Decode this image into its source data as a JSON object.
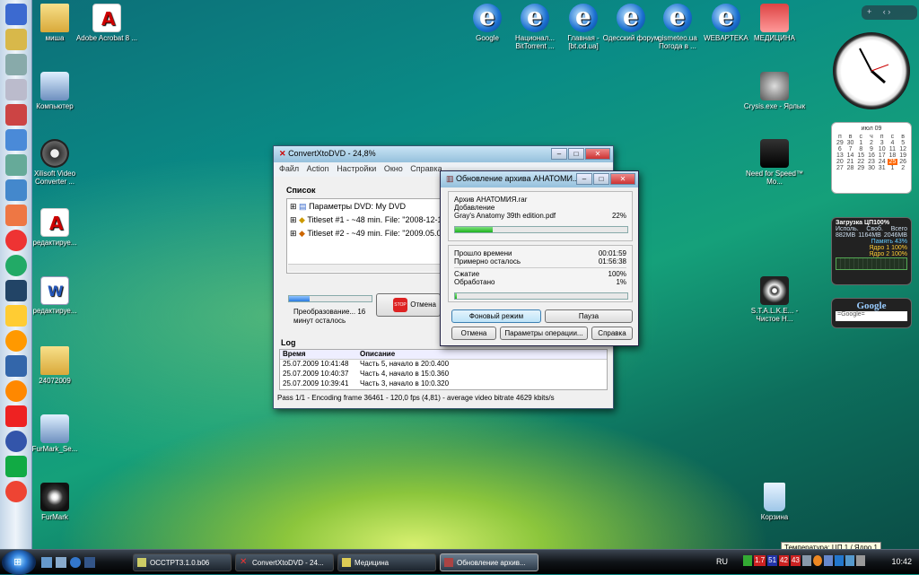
{
  "desktop_icons": [
    {
      "label": "миша",
      "type": "folder"
    },
    {
      "label": "Adobe Acrobat 8 ...",
      "type": "pdf"
    },
    {
      "label": "Компьютер",
      "type": "computer"
    },
    {
      "label": "Xilisoft Video Converter ...",
      "type": "film"
    },
    {
      "label": "редактируе...",
      "type": "pdf"
    },
    {
      "label": "редактируе...",
      "type": "doc"
    },
    {
      "label": "24072009",
      "type": "folder"
    },
    {
      "label": "FurMark_Se...",
      "type": "app"
    },
    {
      "label": "FurMark",
      "type": "game"
    },
    {
      "label": "Google",
      "type": "ie"
    },
    {
      "label": "Национал... BitTorrent ...",
      "type": "ie"
    },
    {
      "label": "Главная - [bt.od.ua]",
      "type": "ie"
    },
    {
      "label": "Одесский форум",
      "type": "ie"
    },
    {
      "label": "gismeteo.ua Погода в ...",
      "type": "ie"
    },
    {
      "label": "WEBAPTEKA",
      "type": "ie"
    },
    {
      "label": "МЕДИЦИНА",
      "type": "med"
    },
    {
      "label": "Crysis.exe - Ярлык",
      "type": "crysis"
    },
    {
      "label": "Need for Speed™ Mo...",
      "type": "nfs"
    },
    {
      "label": "S.T.A.L.K.E... - Чистое Н...",
      "type": "stalker"
    },
    {
      "label": "Корзина",
      "type": "recycle"
    }
  ],
  "convert_window": {
    "title": "ConvertXtoDVD - 24,8%",
    "menu": [
      "Файл",
      "Action",
      "Настройки",
      "Окно",
      "Справка"
    ],
    "list_header": "Список",
    "tree": [
      "Параметры DVD: My DVD",
      "Titleset #1 - ~48 min. File: \"2008-12-13...",
      "Titleset #2 - ~49 min. File: \"2009.05.02..."
    ],
    "progress_pct": 24.8,
    "status": "Преобразование... 16 минут осталось",
    "cancel_label": "Отмена",
    "stop_label": "STOP",
    "log_header": "Log",
    "log_columns": [
      "Время",
      "Описание"
    ],
    "log_rows": [
      {
        "time": "25.07.2009 10:41:48",
        "desc": "Часть 5, начало в 20:0.400"
      },
      {
        "time": "25.07.2009 10:40:37",
        "desc": "Часть 4, начало в 15:0.360"
      },
      {
        "time": "25.07.2009 10:39:41",
        "desc": "Часть 3, начало в 10:0.320"
      }
    ],
    "statusbar": "Pass 1/1 - Encoding frame 36461 - 120,0 fps (4,81) - average video bitrate 4629 kbits/s"
  },
  "rar_window": {
    "title": "Обновление архива АНАТОМИ...",
    "archive": "Архив АНАТОМИЯ.rar",
    "action": "Добавление",
    "file": "Gray's Anatomy 39th edition.pdf",
    "file_pct": "22%",
    "file_progress": 22,
    "elapsed_label": "Прошло времени",
    "elapsed": "00:01:59",
    "remaining_label": "Примерно осталось",
    "remaining": "01:56:38",
    "ratio_label": "Сжатие",
    "ratio": "100%",
    "processed_label": "Обработано",
    "processed": "1%",
    "processed_progress": 1,
    "btn_background": "Фоновый режим",
    "btn_pause": "Пауза",
    "btn_cancel": "Отмена",
    "btn_options": "Параметры операции...",
    "btn_help": "Справка"
  },
  "gadgets": {
    "calendar_month": "июл 09",
    "calendar_days": [
      "п",
      "в",
      "с",
      "ч",
      "п",
      "с",
      "в"
    ],
    "calendar_today": "25",
    "cpu_title": "Загрузка ЦП100%",
    "cpu_cols": [
      "Исполь.",
      "Своб.",
      "Всего"
    ],
    "cpu_mem": [
      "882MB",
      "1164MB",
      "2046MB"
    ],
    "cpu_lines": [
      "Память 43%",
      "Ядро 1 100%",
      "Ядро 2 100%"
    ],
    "google_logo": "Google",
    "google_placeholder": "=Google="
  },
  "tooltip": "Температура: ЦП 1 / Ядро 1",
  "taskbar": {
    "items": [
      "OCCTPT3.1.0.b06",
      "ConvertXtoDVD - 24...",
      "Медицина",
      "Обновление архив..."
    ],
    "lang": "RU",
    "tray_numbers": [
      "1.7",
      "51",
      "42",
      "43"
    ],
    "clock": "10:42"
  }
}
